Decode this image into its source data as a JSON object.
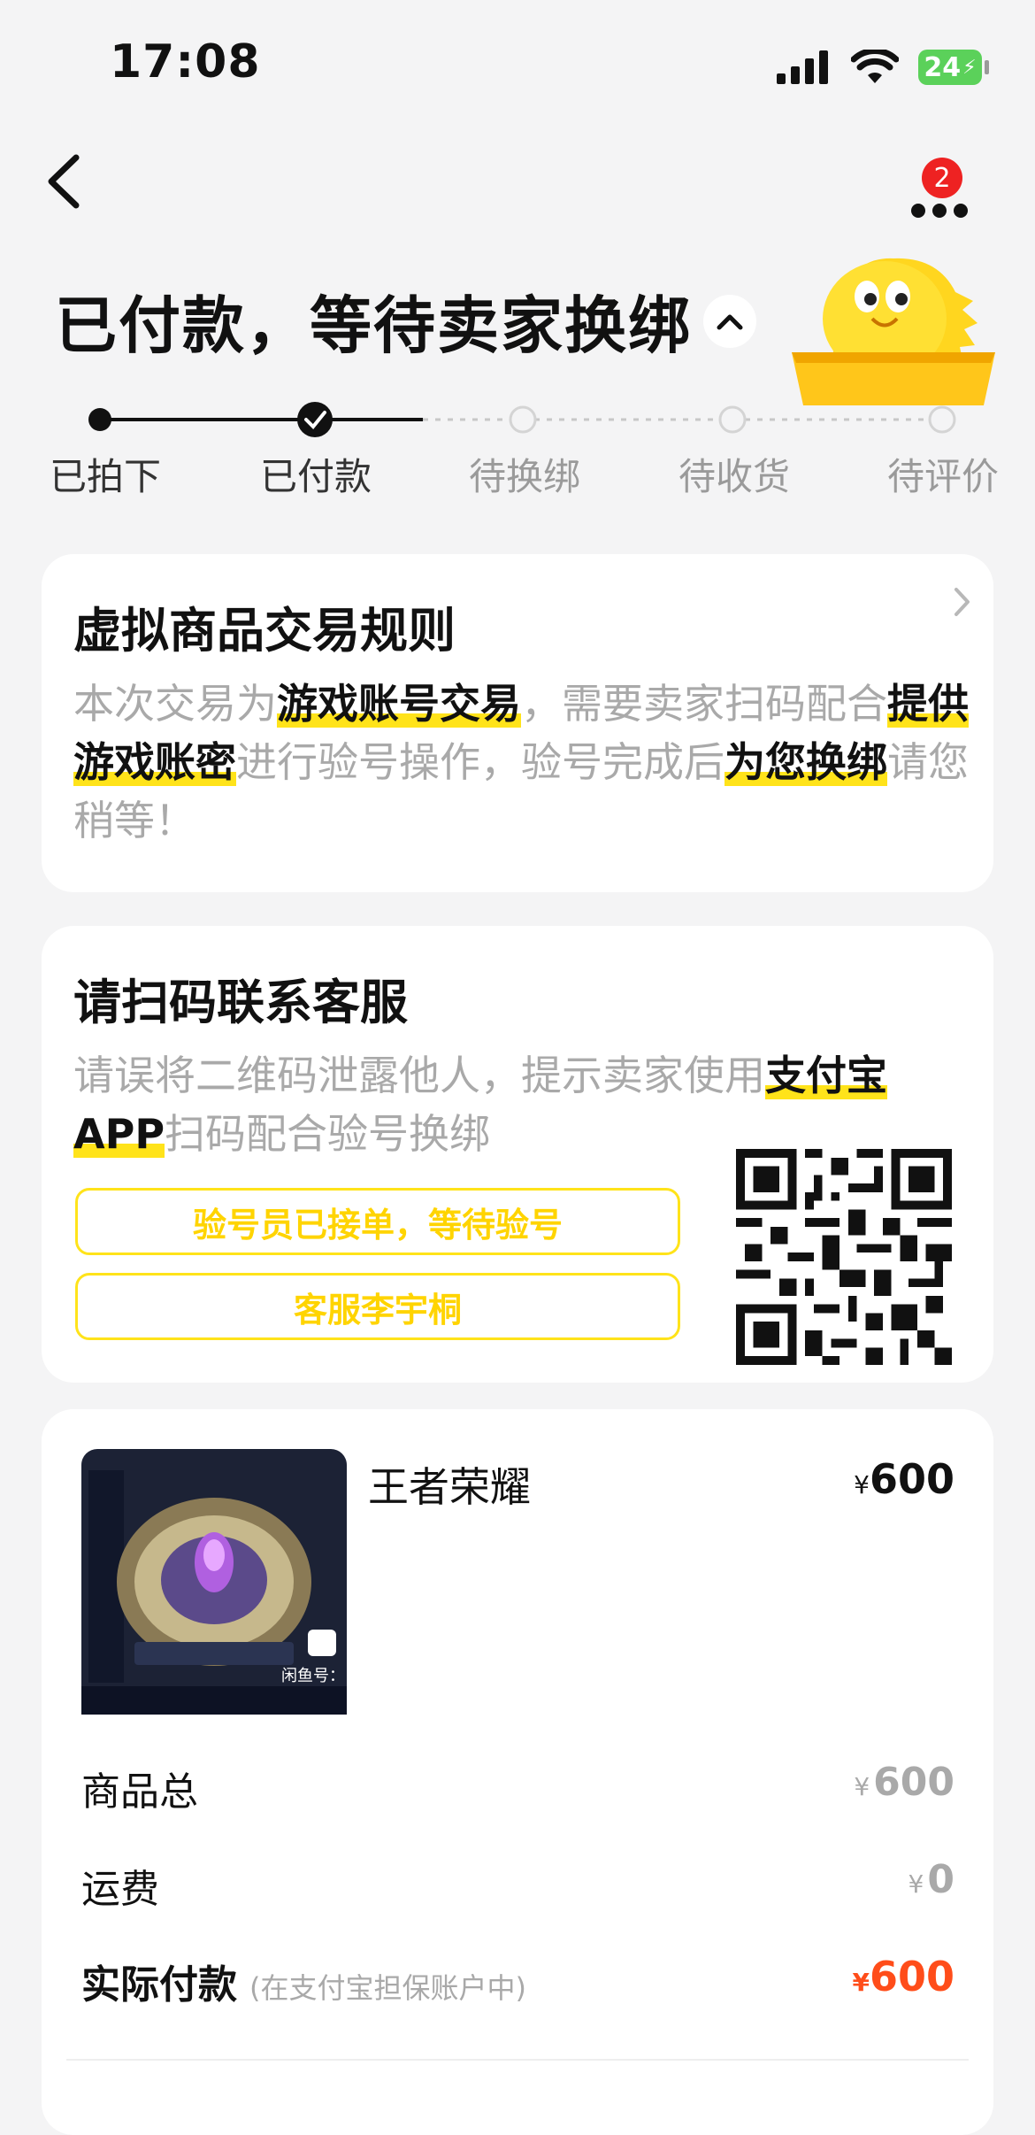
{
  "status_bar": {
    "time": "17:08",
    "battery": "24"
  },
  "nav": {
    "badge_count": "2"
  },
  "header": {
    "title": "已付款，等待卖家换绑"
  },
  "steps": [
    {
      "label": "已拍下",
      "state": "done"
    },
    {
      "label": "已付款",
      "state": "current"
    },
    {
      "label": "待换绑",
      "state": "pending"
    },
    {
      "label": "待收货",
      "state": "pending"
    },
    {
      "label": "待评价",
      "state": "pending"
    }
  ],
  "rules_card": {
    "title": "虚拟商品交易规则",
    "p1": "本次交易为",
    "h1": "游戏账号交易",
    "p2": "，需要卖家扫码配合",
    "h2": "提供游戏账密",
    "p3": "进行验号操作，验号完成后",
    "h3": "为您换绑",
    "p4": "请您稍等！"
  },
  "service_card": {
    "title": "请扫码联系客服",
    "p1": "请误将二维码泄露他人，提示卖家使用",
    "h1": "支付宝APP",
    "p2": "扫码配合验号换绑",
    "button_status": "验号员已接单，等待验号",
    "button_agent": "客服李宇桐"
  },
  "order_card": {
    "product_name": "王者荣耀",
    "product_price": "600",
    "currency": "¥",
    "thumb_caption": "闲鱼号：",
    "rows": [
      {
        "label": "商品总",
        "value": "600"
      },
      {
        "label": "运费",
        "value": "0"
      }
    ],
    "paid_label": "实际付款",
    "paid_note": "(在支付宝担保账户中)",
    "paid_value": "600"
  },
  "colors": {
    "accent_yellow": "#ffe31a",
    "price_red": "#ff4d1a",
    "badge_red": "#ee2222"
  }
}
